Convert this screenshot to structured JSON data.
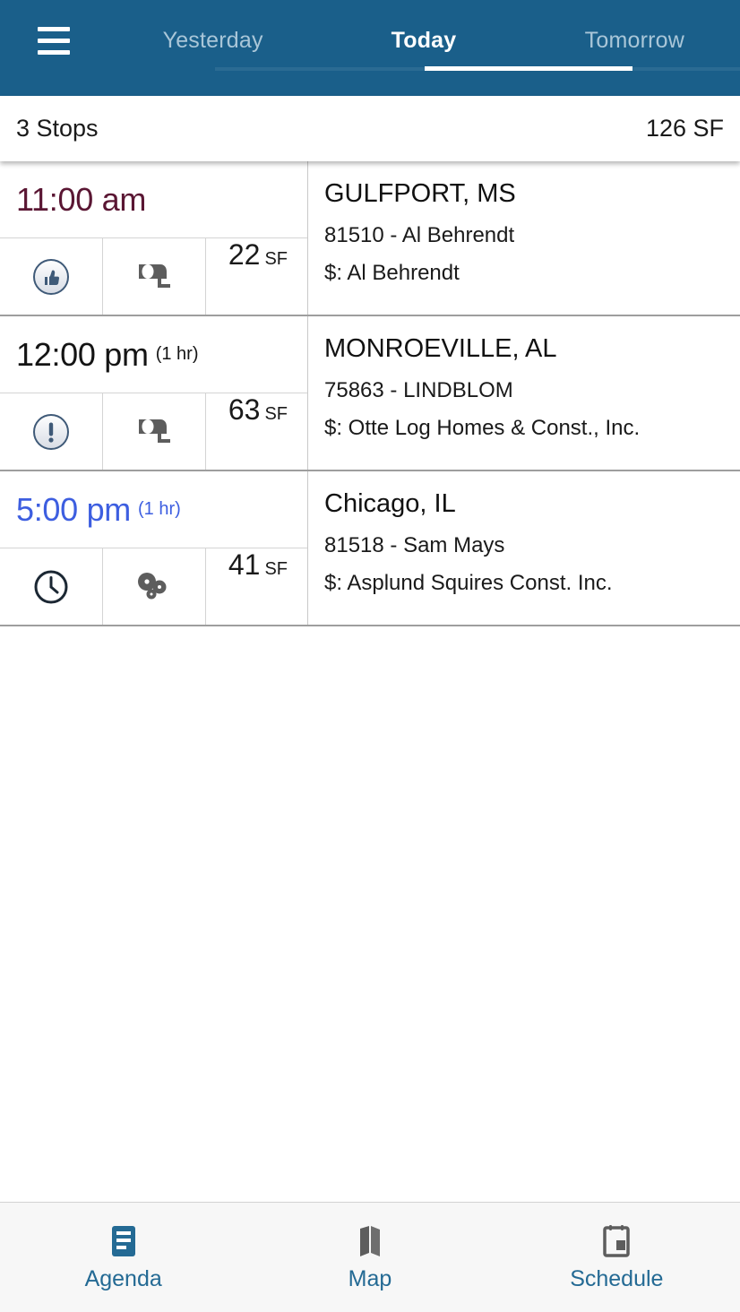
{
  "appbar": {
    "menu_icon": "hamburger-menu-icon",
    "tabs": [
      {
        "label": "Yesterday",
        "active": false
      },
      {
        "label": "Today",
        "active": true
      },
      {
        "label": "Tomorrow",
        "active": false
      }
    ]
  },
  "summary": {
    "stops_label": "3 Stops",
    "total_label": "126 SF"
  },
  "colors": {
    "appbar_bg": "#1a5f8a",
    "tab_active": "#ffffff",
    "tab_inactive": "#a9c6d8",
    "nav_label": "#246a94",
    "time_overdue": "#5a1633",
    "time_normal": "#141414",
    "time_upcoming": "#3d5ee0",
    "row_divider": "#9e9e9e"
  },
  "stops": [
    {
      "time": "11:00 am",
      "duration": "",
      "time_color": "#5a1633",
      "status_icon": "thumbs-up-circle-icon",
      "type_icon": "tape-measure-icon",
      "sf_value": "22",
      "sf_unit": "SF",
      "city": "GULFPORT, MS",
      "job": "81510 - Al Behrendt",
      "customer": "$: Al Behrendt"
    },
    {
      "time": "12:00 pm",
      "duration": "(1 hr)",
      "time_color": "#141414",
      "status_icon": "exclamation-circle-icon",
      "type_icon": "tape-measure-icon",
      "sf_value": "63",
      "sf_unit": "SF",
      "city": "MONROEVILLE, AL",
      "job": "75863 - LINDBLOM",
      "customer": "$: Otte Log Homes & Const., Inc."
    },
    {
      "time": "5:00 pm",
      "duration": "(1 hr)",
      "time_color": "#3d5ee0",
      "status_icon": "clock-circle-icon",
      "type_icon": "gears-icon",
      "sf_value": "41",
      "sf_unit": "SF",
      "city": "Chicago, IL",
      "job": "81518 - Sam Mays",
      "customer": "$: Asplund Squires Const. Inc."
    }
  ],
  "bottomnav": [
    {
      "label": "Agenda",
      "icon": "agenda-list-icon",
      "active": true
    },
    {
      "label": "Map",
      "icon": "map-icon",
      "active": false
    },
    {
      "label": "Schedule",
      "icon": "calendar-icon",
      "active": false
    }
  ]
}
